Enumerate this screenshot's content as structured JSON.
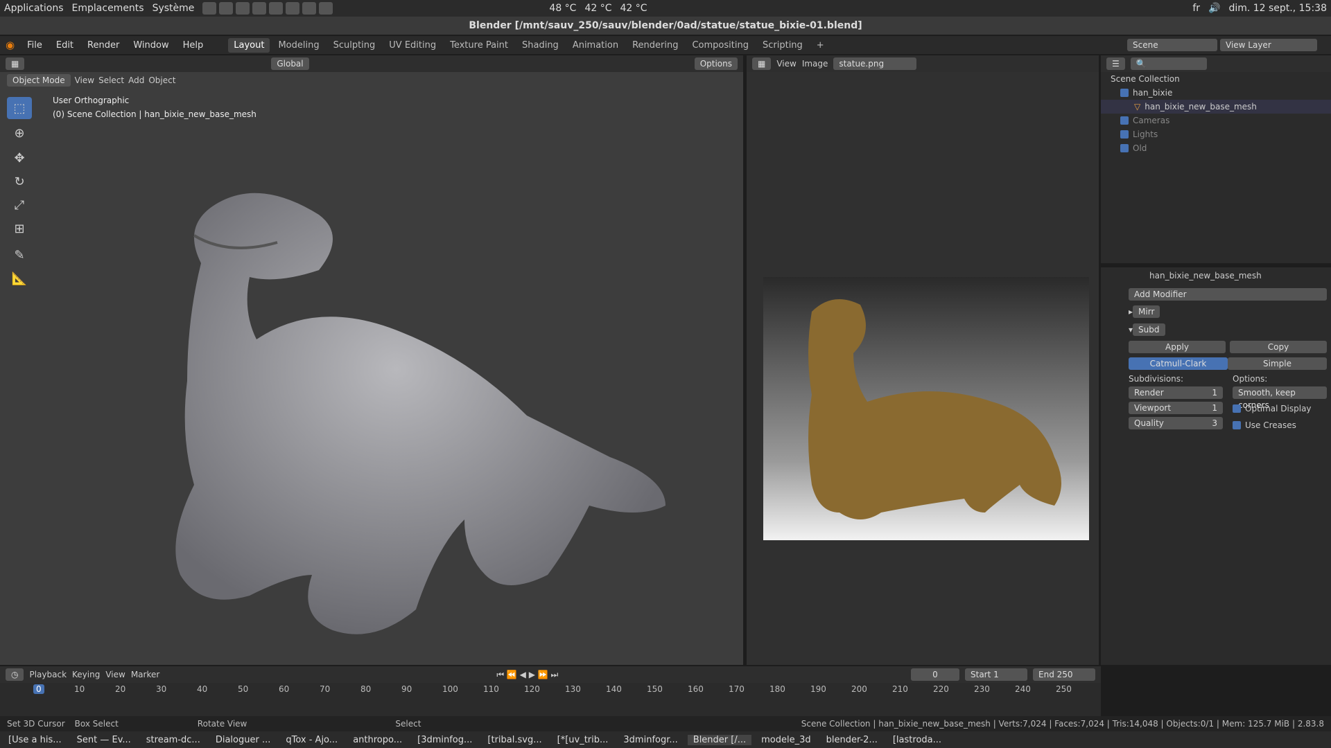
{
  "system": {
    "applications": "Applications",
    "places": "Emplacements",
    "system": "Système",
    "temps": [
      "48 °C",
      "42 °C",
      "42 °C"
    ],
    "lang": "fr",
    "clock": "dim. 12 sept., 15:38"
  },
  "window_title": "Blender [/mnt/sauv_250/sauv/blender/0ad/statue/statue_bixie-01.blend]",
  "menu": [
    "File",
    "Edit",
    "Render",
    "Window",
    "Help"
  ],
  "workspaces": [
    "Layout",
    "Modeling",
    "Sculpting",
    "UV Editing",
    "Texture Paint",
    "Shading",
    "Animation",
    "Rendering",
    "Compositing",
    "Scripting"
  ],
  "active_workspace": "Layout",
  "scene": "Scene",
  "view_layer": "View Layer",
  "viewport": {
    "orientation": "Global",
    "options": "Options",
    "mode": "Object Mode",
    "menus": [
      "View",
      "Select",
      "Add",
      "Object"
    ],
    "info_line1": "User Orthographic",
    "info_line2": "(0) Scene Collection | han_bixie_new_base_mesh"
  },
  "image_editor": {
    "menus": [
      "View",
      "Image"
    ],
    "image_name": "statue.png"
  },
  "outliner": {
    "root": "Scene Collection",
    "items": [
      {
        "name": "han_bixie"
      },
      {
        "name": "han_bixie_new_base_mesh"
      },
      {
        "name": "Cameras"
      },
      {
        "name": "Lights"
      },
      {
        "name": "Old"
      }
    ]
  },
  "properties": {
    "object": "han_bixie_new_base_mesh",
    "add_modifier": "Add Modifier",
    "mod1": "Mirr",
    "mod2": "Subd",
    "apply": "Apply",
    "copy": "Copy",
    "catmull": "Catmull-Clark",
    "simple": "Simple",
    "subdivisions": "Subdivisions:",
    "options": "Options:",
    "render_label": "Render",
    "render_val": "1",
    "viewport_label": "Viewport",
    "viewport_val": "1",
    "quality_label": "Quality",
    "quality_val": "3",
    "uv_smooth": "Smooth, keep corners",
    "optimal": "Optimal Display",
    "creases": "Use Creases"
  },
  "timeline": {
    "menus": [
      "Playback",
      "Keying",
      "View",
      "Marker"
    ],
    "frame": "0",
    "start_label": "Start",
    "start": "1",
    "end_label": "End",
    "end": "250",
    "ticks": [
      "0",
      "10",
      "20",
      "30",
      "40",
      "50",
      "60",
      "70",
      "80",
      "90",
      "100",
      "110",
      "120",
      "130",
      "140",
      "150",
      "160",
      "170",
      "180",
      "190",
      "200",
      "210",
      "220",
      "230",
      "240",
      "250"
    ]
  },
  "status": {
    "a": "Set 3D Cursor",
    "b": "Box Select",
    "c": "Rotate View",
    "d": "Select",
    "stats": "Scene Collection | han_bixie_new_base_mesh | Verts:7,024 | Faces:7,024 | Tris:14,048 | Objects:0/1 | Mem: 125.7 MiB | 2.83.8"
  },
  "taskbar": [
    "[Use a his...",
    "Sent — Ev...",
    "stream-dc...",
    "Dialoguer ...",
    "qTox - Ajo...",
    "anthropo...",
    "[3dminfog...",
    "[tribal.svg...",
    "[*[uv_trib...",
    "3dminfogr...",
    "Blender [/...",
    "modele_3d",
    "blender-2...",
    "[lastroda..."
  ]
}
